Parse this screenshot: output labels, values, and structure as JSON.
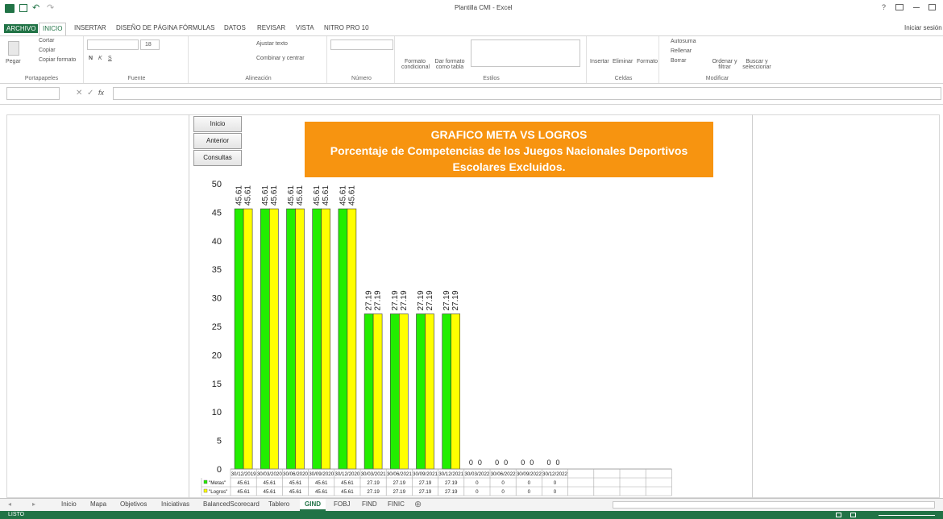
{
  "window": {
    "title": "Plantilla CMI - Excel",
    "signin": "Iniciar sesión",
    "help": "?"
  },
  "ribbon_tabs": [
    "ARCHIVO",
    "INICIO",
    "INSERTAR",
    "DISEÑO DE PÁGINA",
    "FÓRMULAS",
    "DATOS",
    "REVISAR",
    "VISTA",
    "NITRO PRO 10"
  ],
  "ribbon": {
    "clipboard": {
      "paste": "Pegar",
      "cut": "Cortar",
      "copy": "Copiar",
      "copy_format": "Copiar formato",
      "label": "Portapapeles"
    },
    "font": {
      "size": "18",
      "bold": "N",
      "italic": "K",
      "underline": "S",
      "label": "Fuente"
    },
    "alignment": {
      "wrap": "Ajustar texto",
      "merge": "Combinar y centrar",
      "label": "Alineación"
    },
    "number": {
      "label": "Número"
    },
    "styles": {
      "conditional": "Formato condicional",
      "as_table": "Dar formato como tabla",
      "label": "Estilos"
    },
    "cells": {
      "insert": "Insertar",
      "delete": "Eliminar",
      "format": "Formato",
      "label": "Celdas"
    },
    "editing": {
      "autosum": "Autosuma",
      "fill": "Rellenar",
      "clear": "Borrar",
      "sort": "Ordenar y filtrar",
      "find": "Buscar y seleccionar",
      "label": "Modificar"
    }
  },
  "formula_bar": {
    "fx": "fx"
  },
  "nav_buttons": [
    "Inicio",
    "Anterior",
    "Consultas"
  ],
  "chart_title_lines": [
    "GRAFICO META VS LOGROS",
    "Porcentaje de Competencias de los Juegos  Nacionales Deportivos",
    "Escolares Excluidos."
  ],
  "chart_data": {
    "type": "bar",
    "categories": [
      "30/12/2019",
      "30/03/2020",
      "30/06/2020",
      "30/09/2020",
      "30/12/2020",
      "30/03/2021",
      "30/06/2021",
      "30/09/2021",
      "30/12/2021",
      "30/03/2022",
      "30/06/2022",
      "30/09/2022",
      "30/12/2022"
    ],
    "series": [
      {
        "name": "\"Metas\"",
        "values": [
          45.61,
          45.61,
          45.61,
          45.61,
          45.61,
          27.19,
          27.19,
          27.19,
          27.19,
          0,
          0,
          0,
          0
        ],
        "color": "#22ee00"
      },
      {
        "name": "\"Logros\"",
        "values": [
          45.61,
          45.61,
          45.61,
          45.61,
          45.61,
          27.19,
          27.19,
          27.19,
          27.19,
          0,
          0,
          0,
          0
        ],
        "color": "#ffff00"
      }
    ],
    "yticks": [
      0,
      5,
      10,
      15,
      20,
      25,
      30,
      35,
      40,
      45,
      50
    ],
    "ylim": [
      0,
      50
    ],
    "table_labels": [
      "45.61",
      "45.61",
      "45.61",
      "45.61",
      "45.61",
      "27.19",
      "27.19",
      "27.19",
      "27.19",
      "0",
      "0",
      "0",
      "0"
    ],
    "legend": "data-table"
  },
  "sheet_tabs": [
    "Inicio",
    "Mapa",
    "Objetivos",
    "Iniciativas",
    "BalancedScorecard",
    "Tablero",
    "GIND",
    "FOBJ",
    "FIND",
    "FINIC"
  ],
  "active_sheet": "GIND",
  "status": {
    "ready": "LISTO"
  }
}
